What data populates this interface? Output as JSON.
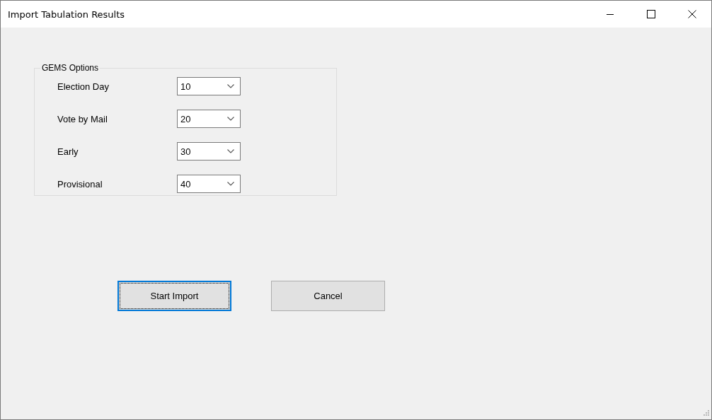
{
  "window": {
    "title": "Import Tabulation Results"
  },
  "group": {
    "title": "GEMS Options",
    "fields": [
      {
        "label": "Election Day",
        "value": "10"
      },
      {
        "label": "Vote by Mail",
        "value": "20"
      },
      {
        "label": "Early",
        "value": "30"
      },
      {
        "label": "Provisional",
        "value": "40"
      }
    ]
  },
  "buttons": [
    {
      "label": "Start Import",
      "focused": true
    },
    {
      "label": "Cancel",
      "focused": false
    }
  ]
}
